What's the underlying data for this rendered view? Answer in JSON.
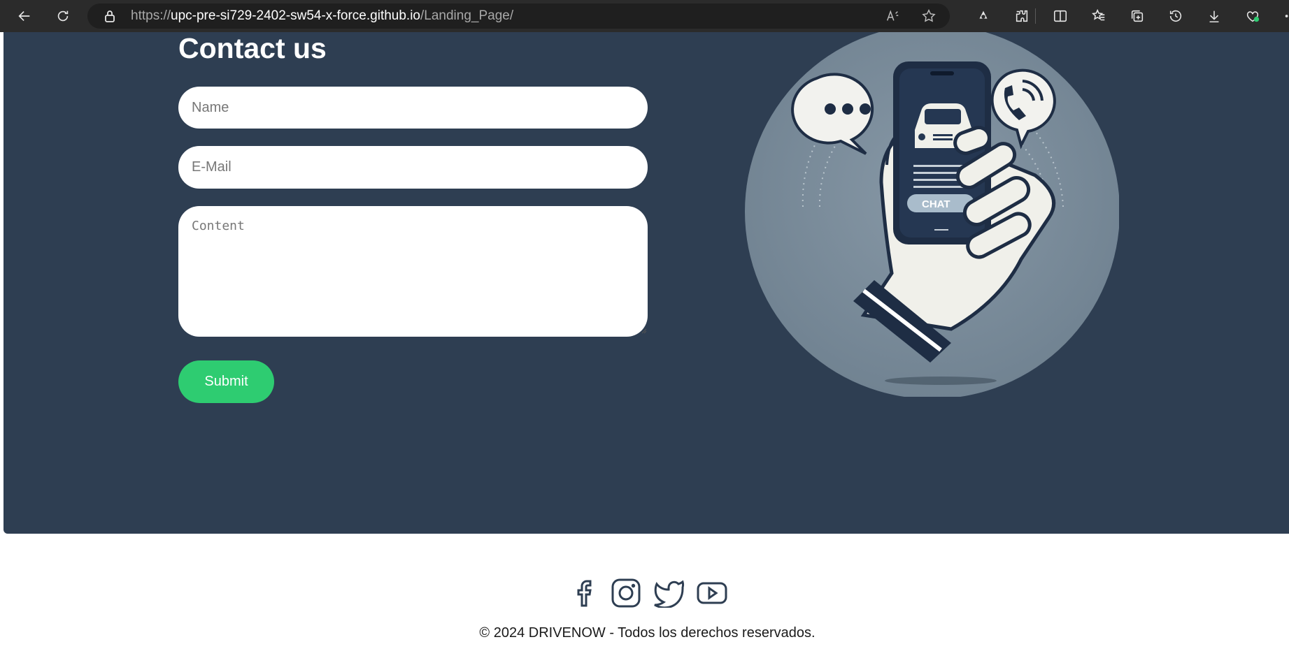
{
  "browser": {
    "url_base": "https://",
    "url_host": "upc-pre-si729-2402-sw54-x-force.github.io",
    "url_path": "/Landing_Page/"
  },
  "contact": {
    "title": "Contact us",
    "name_placeholder": "Name",
    "email_placeholder": "E-Mail",
    "content_placeholder": "Content",
    "submit_label": "Submit",
    "illustration_label": "CHAT"
  },
  "footer": {
    "social_icons": [
      "facebook-icon",
      "instagram-icon",
      "twitter-icon",
      "youtube-icon"
    ],
    "copyright": "© 2024 DRIVENOW - Todos los derechos reservados."
  },
  "colors": {
    "section_bg": "#2e3e52",
    "accent": "#2ecc71",
    "browser_bar": "#2b2b2b"
  }
}
